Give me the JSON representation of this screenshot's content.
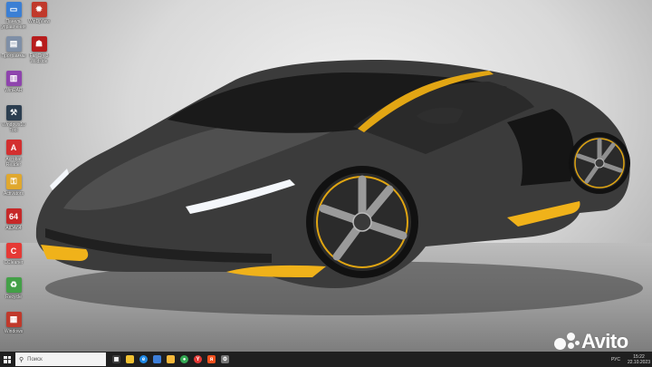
{
  "desktop": {
    "column1": [
      {
        "label": "Панель управления",
        "icon": "monitor-icon",
        "color": "#3b7fd4"
      },
      {
        "label": "Программы",
        "icon": "programs-icon",
        "color": "#7f8fa6"
      },
      {
        "label": "WinRAR",
        "icon": "winrar-icon",
        "color": "#8e44ad"
      },
      {
        "label": "Windows10 Tool",
        "icon": "toolbox-icon",
        "color": "#2c3e50"
      },
      {
        "label": "Acrobat Reader",
        "icon": "pdf-icon",
        "color": "#d32f2f"
      },
      {
        "label": "Activators",
        "icon": "key-icon",
        "color": "#e0a82e"
      },
      {
        "label": "AIDA64",
        "icon": "aida64-icon",
        "color": "#c62828"
      },
      {
        "label": "CCleaner",
        "icon": "ccleaner-icon",
        "color": "#e53935"
      },
      {
        "label": "Recycle",
        "icon": "recycle-icon",
        "color": "#43a047"
      },
      {
        "label": "Windows",
        "icon": "windows-app-icon",
        "color": "#c0392b"
      }
    ],
    "column2": [
      {
        "label": "WinDjView",
        "icon": "flame-icon",
        "color": "#c0392b"
      },
      {
        "label": "Far Cry 3 Wildside",
        "icon": "game-icon",
        "color": "#b71c1c"
      }
    ]
  },
  "taskbar": {
    "search_placeholder": "Поиск",
    "pinned": [
      {
        "name": "task-view-icon",
        "color": "#3d3d3d",
        "glyph": "▦"
      },
      {
        "name": "explorer-icon",
        "color": "#f1c232",
        "glyph": ""
      },
      {
        "name": "edge-icon",
        "color": "#1e88e5",
        "glyph": "e"
      },
      {
        "name": "store-icon",
        "color": "#3d7fd9",
        "glyph": ""
      },
      {
        "name": "files-icon",
        "color": "#f6b93b",
        "glyph": ""
      },
      {
        "name": "chrome-icon",
        "color": "#34a853",
        "glyph": "●"
      },
      {
        "name": "yandex-icon",
        "color": "#e53935",
        "glyph": "Y"
      },
      {
        "name": "yandex-browser-icon",
        "color": "#f4511e",
        "glyph": "я"
      },
      {
        "name": "settings-icon",
        "color": "#777777",
        "glyph": "⚙"
      }
    ],
    "tray": {
      "language": "РУС",
      "time": "15:22",
      "date": "22.10.2023"
    }
  },
  "watermark": {
    "text": "Avito"
  }
}
